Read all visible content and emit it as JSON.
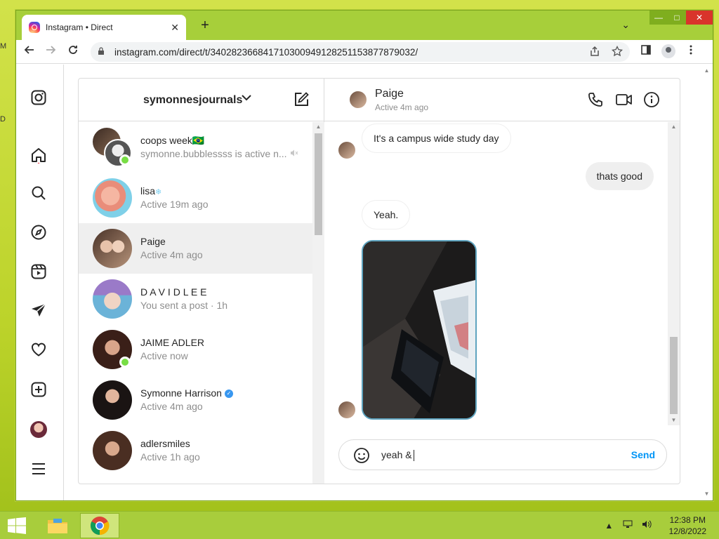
{
  "browser": {
    "tab_title": "Instagram • Direct",
    "url": "instagram.com/direct/t/340282366841710300949128251153877879032/",
    "new_tab_symbol": "+",
    "tab_close_symbol": "✕",
    "tab_search_symbol": "⌄"
  },
  "desktop": {
    "edge_label_1": "M",
    "edge_label_2": "D"
  },
  "instagram": {
    "account_name": "symonnesjournals",
    "threads": [
      {
        "name": "coops week🇧🇷",
        "subtitle": "symonne.bubblessss is active n...",
        "muted": true,
        "online": true,
        "group": true
      },
      {
        "name": "lisa",
        "subtitle": "Active 19m ago",
        "badge": "❄"
      },
      {
        "name": "Paige",
        "subtitle": "Active 4m ago",
        "active": true
      },
      {
        "name": "D A V I D L E E",
        "subtitle": "You sent a post · 1h"
      },
      {
        "name": "JAIME ADLER",
        "subtitle": "Active now",
        "online": true
      },
      {
        "name": "Symonne Harrison",
        "subtitle": "Active 4m ago",
        "verified": true
      },
      {
        "name": "adlersmiles",
        "subtitle": "Active 1h ago"
      }
    ],
    "chat": {
      "contact_name": "Paige",
      "contact_status": "Active 4m ago",
      "messages": [
        {
          "direction": "in",
          "text": "It's a campus wide study day"
        },
        {
          "direction": "out",
          "text": "thats good"
        },
        {
          "direction": "in",
          "text": "Yeah."
        },
        {
          "direction": "in",
          "type": "photo",
          "text": ""
        }
      ],
      "composer_value": "yeah &",
      "send_label": "Send"
    },
    "colors": {
      "accent_blue": "#0095f6",
      "online_green": "#78de45",
      "verified_blue": "#3897f0"
    }
  },
  "taskbar": {
    "time": "12:38 PM",
    "date": "12/8/2022"
  }
}
